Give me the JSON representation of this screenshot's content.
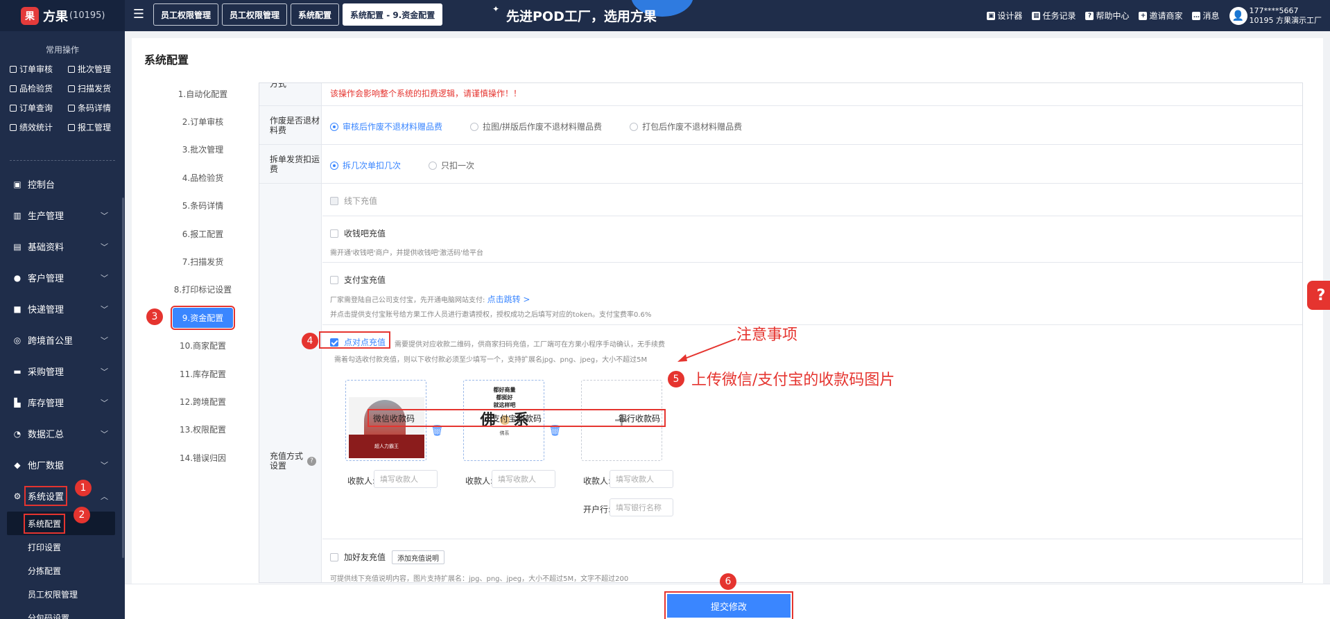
{
  "app": {
    "name": "方果",
    "id": "(10195)",
    "logo_char": "果"
  },
  "tabs": [
    {
      "label": "员工权限管理",
      "active": false
    },
    {
      "label": "员工权限管理",
      "active": false
    },
    {
      "label": "系统配置",
      "active": false
    },
    {
      "label": "系统配置 - 9.资金配置",
      "active": true
    }
  ],
  "banner": {
    "text": "先进POD工厂，选用方果"
  },
  "top_right": {
    "designer": "设计器",
    "tasks": "任务记录",
    "help": "帮助中心",
    "invite": "邀请商家",
    "messages": "消息",
    "user_phone": "177****5667",
    "user_org": "10195 方果演示工厂"
  },
  "sidebar": {
    "section_title": "常用操作",
    "quick": [
      "订单审核",
      "批次管理",
      "品检验货",
      "扫描发货",
      "订单查询",
      "条码详情",
      "绩效统计",
      "报工管理"
    ],
    "nav": [
      {
        "label": "控制台",
        "icon": "dashboard-icon"
      },
      {
        "label": "生产管理",
        "icon": "production-icon"
      },
      {
        "label": "基础资料",
        "icon": "database-icon"
      },
      {
        "label": "客户管理",
        "icon": "customer-icon"
      },
      {
        "label": "快递管理",
        "icon": "express-icon"
      },
      {
        "label": "跨境首公里",
        "icon": "globe-icon"
      },
      {
        "label": "采购管理",
        "icon": "purchase-icon"
      },
      {
        "label": "库存管理",
        "icon": "warehouse-icon"
      },
      {
        "label": "数据汇总",
        "icon": "pie-icon"
      },
      {
        "label": "他厂数据",
        "icon": "factory-icon"
      },
      {
        "label": "系统设置",
        "icon": "settings-icon"
      }
    ],
    "sub": [
      "系统配置",
      "打印设置",
      "分拣配置",
      "员工权限管理",
      "分包码设置"
    ]
  },
  "page": {
    "title": "系统配置"
  },
  "steps": [
    "1.自动化配置",
    "2.订单审核",
    "3.批次管理",
    "4.品检验货",
    "5.条码详情",
    "6.报工配置",
    "7.扫描发货",
    "8.打印标记设置",
    "9.资金配置",
    "10.商家配置",
    "11.库存配置",
    "12.跨境配置",
    "13.权限配置",
    "14.错误归因"
  ],
  "form": {
    "row0_label": "方式",
    "warning": "该操作会影响整个系统的扣费逻辑，请谨慎操作！！",
    "material": {
      "label": "作废是否退材料费",
      "options": [
        "审核后作废不退材料赠品费",
        "拉图/拼版后作废不退材料赠品费",
        "打包后作废不退材料赠品费"
      ],
      "selected": 0
    },
    "split": {
      "label": "拆单发货扣运费",
      "options": [
        "拆几次单扣几次",
        "只扣一次"
      ],
      "selected": 0
    },
    "recharge": {
      "label": "充值方式设置",
      "offline": "线下充值",
      "shouqianba": "收钱吧充值",
      "shouqianba_hint": "需开通'收钱吧'商户，并提供收钱吧'激活码'给平台",
      "alipay": "支付宝充值",
      "alipay_hint": "厂家需登陆自己公司支付宝，先开通电脑网站支付:",
      "alipay_link": "点击跳转 >",
      "alipay_hint2": "并点击提供支付宝账号给方果工作人员进行邀请授权，授权成功之后填写对应的token。支付宝费率0.6%",
      "p2p": "点对点充值",
      "p2p_hint": "需要提供对应收款二维码，供商家扫码充值，工厂端可在方果小程序手动确认，无手续费",
      "p2p_hint2": "需着勾选收付款充值，则以下收付款必须至少填写一个，支持扩展名jpg、png、jpeg，大小不超过5M",
      "qr_headers": [
        "微信收款码",
        "支付宝收款码",
        "银行收款码"
      ],
      "payee_label": "收款人:",
      "payee_placeholder": "填写收款人",
      "bank_label": "开户行:",
      "bank_placeholder": "填写银行名称",
      "friend": "加好友充值",
      "friend_btn": "添加充值说明",
      "friend_hint": "可提供线下充值说明内容，图片支持扩展名：jpg、png、jpeg，大小不超过5M，文字不超过200"
    }
  },
  "annotations": {
    "note": "注意事项",
    "upload": "上传微信/支付宝的收款码图片",
    "badges": [
      "1",
      "2",
      "3",
      "4",
      "5",
      "6"
    ]
  },
  "qr_images": {
    "wechat_caption": "超人力霸王",
    "alipay_lines": [
      "都好商量",
      "都挺好",
      "就这样吧",
      "佛系"
    ],
    "alipay_big": "佛",
    "alipay_big2": "系"
  },
  "footer": {
    "submit": "提交修改"
  },
  "colors": {
    "primary": "#3a86ff",
    "annotation": "#e5342f",
    "nav_bg": "#1f2d4a"
  }
}
